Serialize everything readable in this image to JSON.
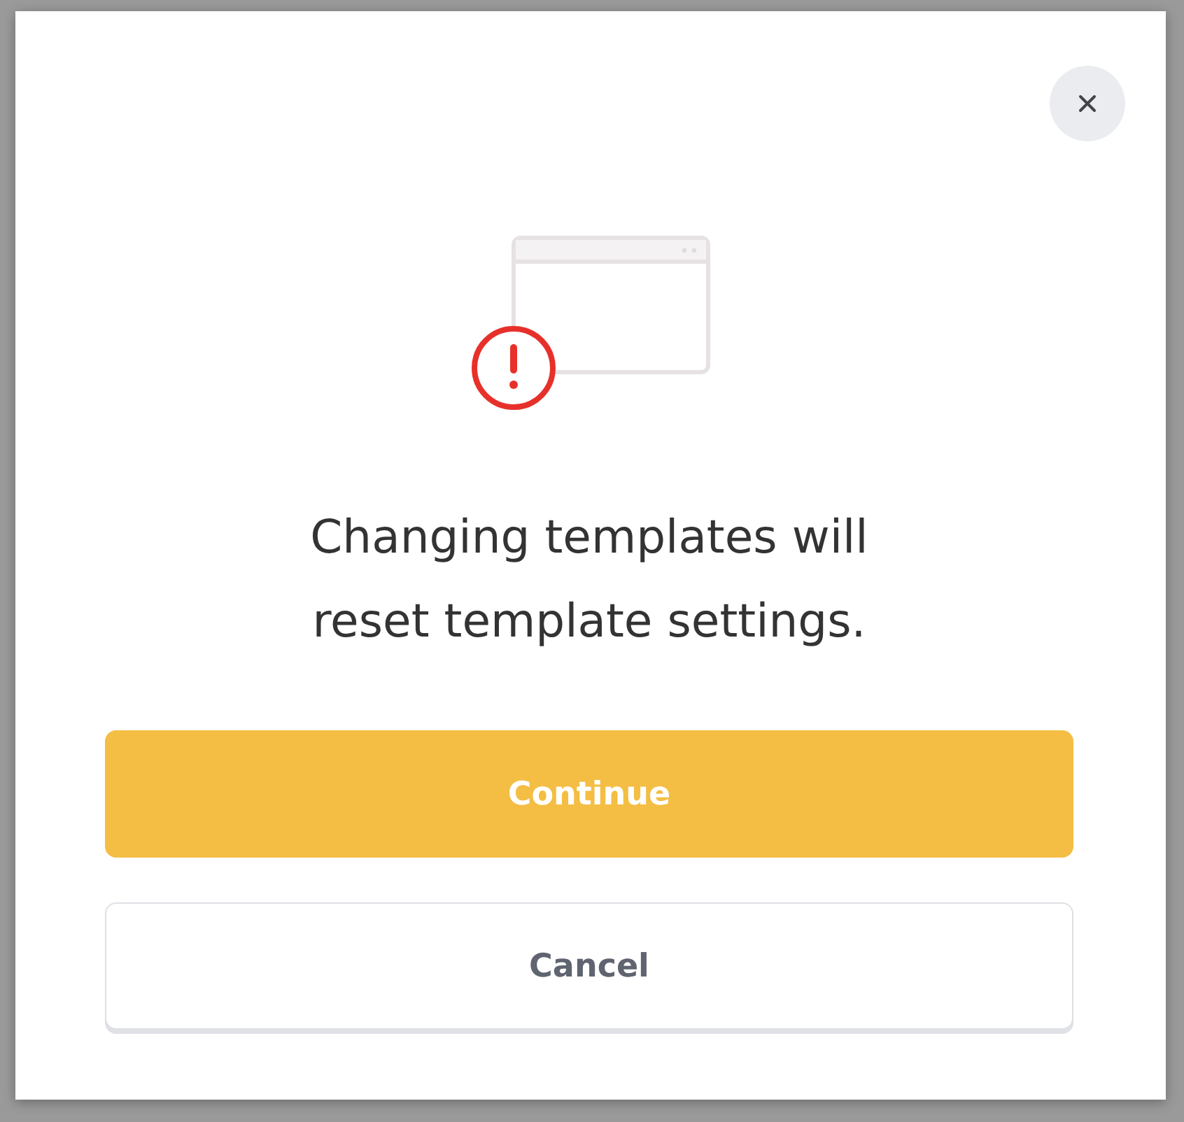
{
  "dialog": {
    "message": "Changing templates will reset template settings.",
    "buttons": [
      {
        "label": "Continue",
        "kind": "primary"
      },
      {
        "label": "Cancel",
        "kind": "secondary"
      }
    ]
  }
}
